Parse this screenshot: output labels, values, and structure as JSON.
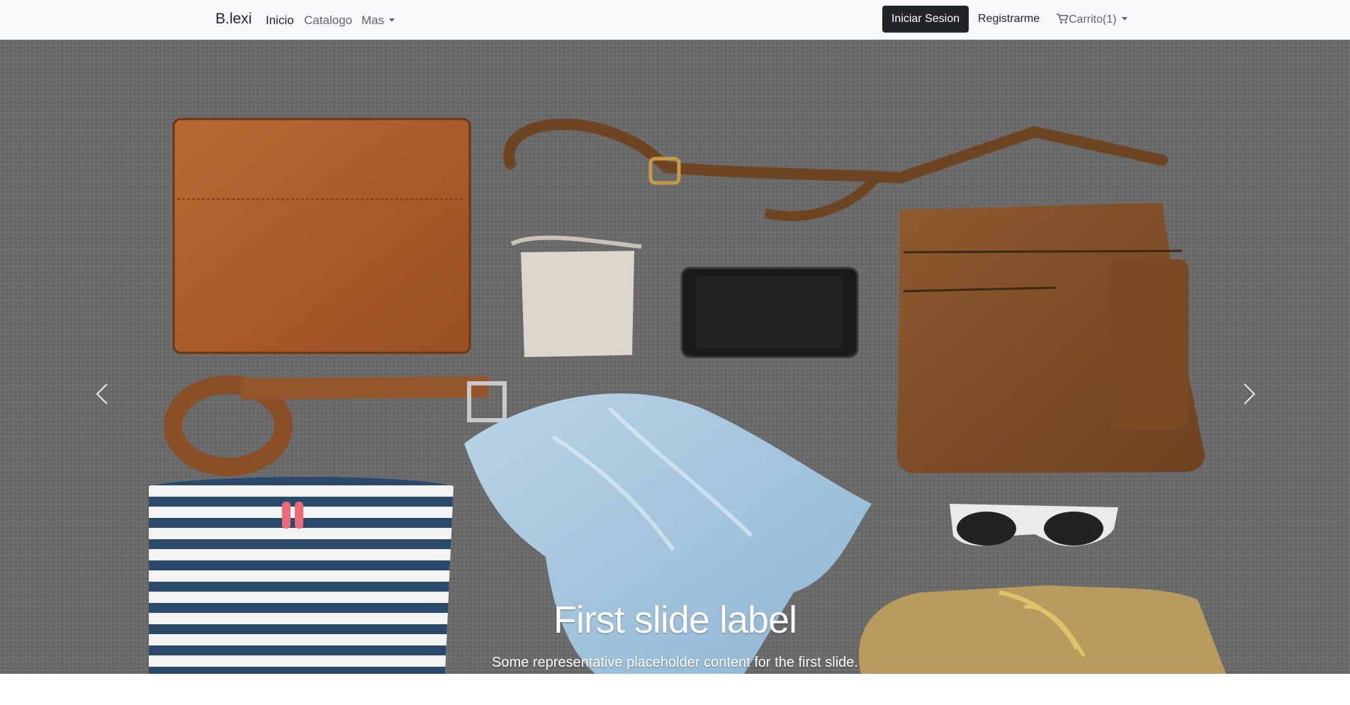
{
  "navbar": {
    "brand": "B.lexi",
    "links": [
      {
        "label": "Inicio",
        "active": true
      },
      {
        "label": "Catalogo",
        "active": false
      },
      {
        "label": "Mas",
        "dropdown": true
      }
    ],
    "login_label": "Iniciar Sesion",
    "register_label": "Registrarme",
    "cart_label": "Carrito(1)",
    "cart_icon": "cart-icon"
  },
  "carousel": {
    "slide_title": "First slide label",
    "slide_text": "Some representative placeholder content for the first slide.",
    "prev_icon": "chevron-left-icon",
    "next_icon": "chevron-right-icon",
    "active_slide": 1
  },
  "colors": {
    "navbar_bg": "#f8f9fa",
    "button_dark": "#212529",
    "carpet": "#6b6b6b"
  }
}
